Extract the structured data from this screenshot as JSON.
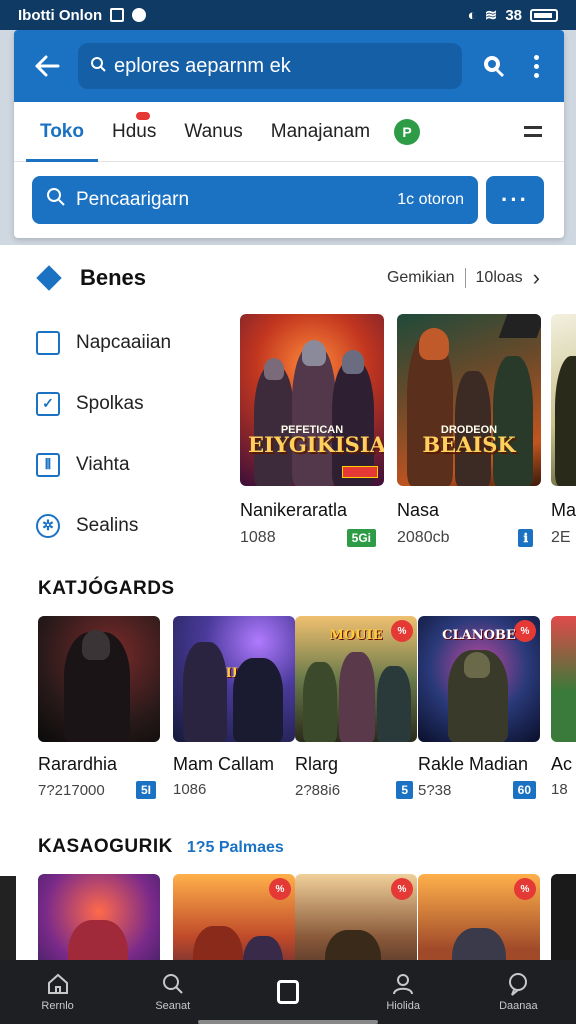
{
  "status_bar": {
    "left_text": "Ibotti Onlon",
    "right_text": "38"
  },
  "app_bar": {
    "url_text": "eplores aeparnm ek"
  },
  "tabs": [
    {
      "label": "Toko",
      "active": true
    },
    {
      "label": "Hdus",
      "active": false
    },
    {
      "label": "Wanus",
      "active": false
    },
    {
      "label": "Manajanam",
      "active": false
    }
  ],
  "tab_badge_letter": "P",
  "search": {
    "placeholder": "Pencaarigarn",
    "meta": "1c otoron",
    "more_label": "···"
  },
  "featured": {
    "title": "Benes",
    "right_link": "Gemikian",
    "right_count": "10loas"
  },
  "side_menu": [
    {
      "label": "Napcaaiian",
      "icon": "window-icon"
    },
    {
      "label": "Spolkas",
      "icon": "checkbox-icon"
    },
    {
      "label": "Viahta",
      "icon": "columns-icon"
    },
    {
      "label": "Sealins",
      "icon": "gear-icon"
    }
  ],
  "featured_games": [
    {
      "art_title": "EIYGIKISIA",
      "art_sub": "PEFETICAN",
      "name": "Nanikeraratla",
      "count": "1088",
      "tag": "5Gi"
    },
    {
      "art_title": "BEAISK",
      "art_sub": "DRODEON",
      "name": "Nasa",
      "count": "2080cb",
      "tag": "ℹ"
    },
    {
      "art_title": "",
      "art_sub": "",
      "name": "Ma",
      "count": "2E",
      "tag": ""
    }
  ],
  "category_1": {
    "title": "KATJÓGARDS",
    "games": [
      {
        "name": "Rarardhia",
        "count": "7?217000",
        "tag": "5I",
        "art_title": ""
      },
      {
        "name": "Mam Callam",
        "count": "1086",
        "tag": "",
        "art_title": "BIRIIGAD"
      },
      {
        "name": "Rlarg",
        "count": "2?88i6",
        "tag": "5",
        "art_title": "MOUIE"
      },
      {
        "name": "Rakle Madian",
        "count": "5?38",
        "tag": "60",
        "art_title": "CLANOBE"
      },
      {
        "name": "Ac",
        "count": "18",
        "tag": "",
        "art_title": ""
      }
    ]
  },
  "category_2": {
    "title": "KASAOGURIK",
    "subtitle": "1?5 Palmaes"
  },
  "bottom_nav": [
    {
      "label": "Rernlo",
      "icon": "home-icon"
    },
    {
      "label": "Seanat",
      "icon": "search-icon"
    },
    {
      "label": "",
      "icon": "square-icon"
    },
    {
      "label": "Hiolida",
      "icon": "person-icon"
    },
    {
      "label": "Daanaa",
      "icon": "chat-icon"
    }
  ]
}
